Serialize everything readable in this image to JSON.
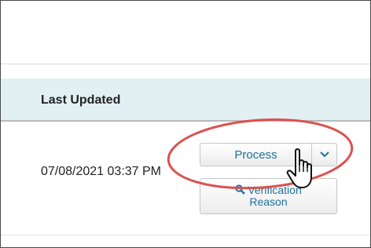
{
  "table": {
    "column_header": "Last Updated",
    "row": {
      "last_updated": "07/08/2021 03:37 PM"
    }
  },
  "actions": {
    "process_label": "Process",
    "verification_label_line1": "Verification",
    "verification_label_line2": "Reason",
    "search_icon": "search-icon",
    "dropdown_icon": "chevron-down-icon"
  },
  "annotation": {
    "highlight_color": "#d9534f",
    "cursor_icon": "hand-pointer-icon"
  },
  "colors": {
    "header_bg": "#e2f0f4",
    "button_text": "#1f6f9c"
  }
}
